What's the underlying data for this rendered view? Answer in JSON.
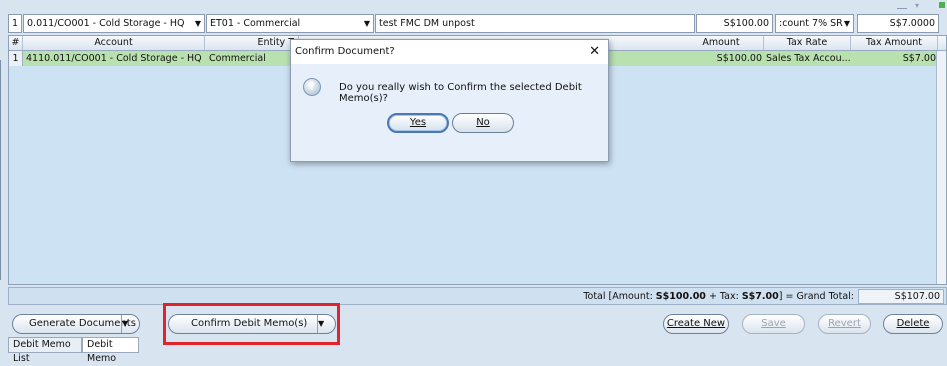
{
  "edit_row": {
    "row_no": "1",
    "account": "0.011/CO001 - Cold Storage - HQ",
    "entity_type": "ET01 - Commercial",
    "description": "test FMC DM unpost",
    "amount": "S$100.00",
    "tax_rate": ":count 7% SR",
    "tax_amount": "S$7.0000"
  },
  "grid": {
    "columns": [
      "#",
      "Account",
      "Entity T",
      "Amount",
      "Tax Rate",
      "Tax Amount"
    ],
    "rows": [
      {
        "no": "1",
        "account": "4110.011/CO001 - Cold Storage - HQ",
        "entity_type": "Commercial",
        "amount": "S$100.00",
        "tax_rate": "Sales Tax Accou...",
        "tax_amount": "S$7.00"
      }
    ]
  },
  "totals": {
    "prefix": "Total [Amount: ",
    "amount": "S$100.00",
    "mid": " + Tax: ",
    "tax": "S$7.00",
    "suffix": "] = Grand Total:",
    "grand_total": "S$107.00"
  },
  "buttons": {
    "generate_documents": "Generate Documents",
    "confirm_debit_memo": "Confirm Debit Memo(s)",
    "create_new": "Create New",
    "save": "Save",
    "revert": "Revert",
    "delete": "Delete"
  },
  "tabs": [
    "Debit Memo List",
    "Debit Memo"
  ],
  "dialog": {
    "title": "Confirm Document?",
    "message": "Do you really wish to Confirm the selected Debit Memo(s)?",
    "yes": "Yes",
    "no": "No"
  },
  "colors": {
    "highlight": "#e0242c",
    "selected_row": "#b9e1b0"
  }
}
